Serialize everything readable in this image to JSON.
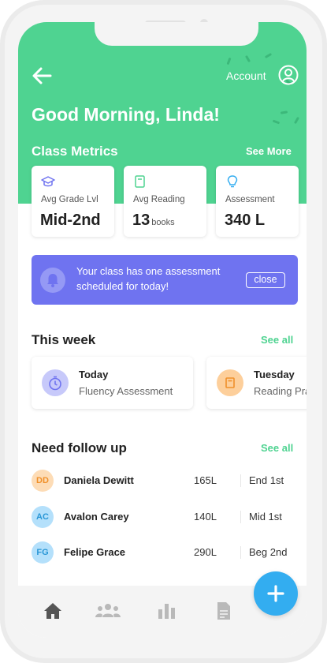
{
  "header": {
    "account_label": "Account",
    "greeting": "Good Morning, Linda!",
    "metrics_title": "Class Metrics",
    "see_more": "See More"
  },
  "metrics": [
    {
      "icon": "graduation-cap-icon",
      "label": "Avg Grade Lvl",
      "value": "Mid-2nd",
      "unit": ""
    },
    {
      "icon": "book-icon",
      "label": "Avg Reading",
      "value": "13",
      "unit": "books"
    },
    {
      "icon": "lightbulb-icon",
      "label": "Assessment",
      "value": "340 L",
      "unit": ""
    }
  ],
  "banner": {
    "message": "Your class has one assessment scheduled for today!",
    "close_label": "close"
  },
  "this_week": {
    "title": "This week",
    "see_all": "See all",
    "items": [
      {
        "day": "Today",
        "desc": "Fluency Assessment",
        "icon": "timer-icon"
      },
      {
        "day": "Tuesday",
        "desc": "Reading Practice",
        "icon": "book-icon"
      }
    ]
  },
  "follow_up": {
    "title": "Need follow up",
    "see_all": "See all",
    "students": [
      {
        "initials": "DD",
        "name": "Daniela Dewitt",
        "lexile": "165L",
        "level": "End 1st"
      },
      {
        "initials": "AC",
        "name": "Avalon Carey",
        "lexile": "140L",
        "level": "Mid 1st"
      },
      {
        "initials": "FG",
        "name": "Felipe Grace",
        "lexile": "290L",
        "level": "Beg 2nd"
      }
    ]
  },
  "nav": {
    "tabs": [
      "home-icon",
      "group-icon",
      "bar-chart-icon",
      "document-icon"
    ],
    "fab_icon": "plus-icon"
  },
  "colors": {
    "brand_green": "#4fd391",
    "banner_purple": "#6f73f0",
    "fab_blue": "#33adf0"
  }
}
